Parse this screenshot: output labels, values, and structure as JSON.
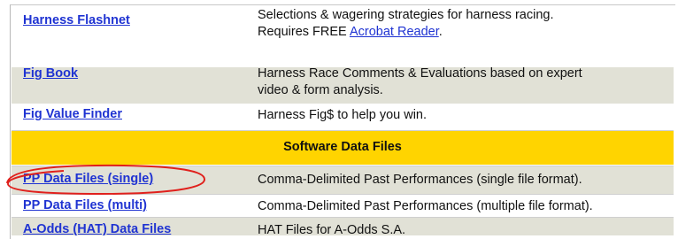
{
  "rows": [
    {
      "name": "Harness Flashnet",
      "desc_line1": "Selections & wagering strategies for harness racing.",
      "desc_line2_prefix": "Requires FREE ",
      "desc_line2_link": "Acrobat Reader",
      "desc_line2_suffix": "."
    },
    {
      "name": "Fig Book",
      "desc_line1": "Harness Race Comments & Evaluations based on expert",
      "desc_line2": "video & form analysis."
    },
    {
      "name": "Fig Value Finder",
      "desc": "Harness Fig$ to help you win."
    },
    {
      "section_title": "Software Data Files"
    },
    {
      "name": "PP Data Files (single)",
      "desc": "Comma-Delimited Past Performances (single file format)."
    },
    {
      "name": "PP Data Files (multi)",
      "desc": "Comma-Delimited Past Performances (multiple file format)."
    },
    {
      "name": "A-Odds (HAT) Data Files",
      "desc": "HAT Files for A-Odds S.A."
    }
  ],
  "colors": {
    "link": "#1f33d2",
    "row_gray": "#e1e1d6",
    "section_gold": "#ffd400",
    "annotation_red": "#e0201c"
  }
}
